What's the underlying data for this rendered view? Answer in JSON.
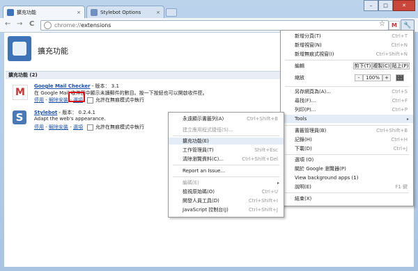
{
  "window": {
    "min_label": "–",
    "max_label": "□",
    "close_label": "✕",
    "tabs": [
      {
        "title": "擴充功能",
        "close": "×"
      },
      {
        "title": "Stylebot Options",
        "close": "×"
      }
    ]
  },
  "toolbar": {
    "back": "←",
    "forward": "→",
    "reload": "C",
    "url_prefix": "chrome://",
    "url_main": "extensions",
    "star": "☆",
    "gmail": "M",
    "wrench": "🔧"
  },
  "page": {
    "title": "擴充功能",
    "section": "擴充功能 (2)",
    "extensions": [
      {
        "icon": "gmail-icon",
        "icon_glyph": "M",
        "name": "Google Mail Checker",
        "version": " - 版本： 3.1",
        "description": "在 Google Mail 收件匣中顯示未讀郵件的數目。按一下按鈕也可以開啟收件匣。",
        "links": [
          "停用",
          "解除安裝",
          "選項"
        ],
        "incognito": "允許在無痕模式中執行"
      },
      {
        "icon": "stylebot-icon",
        "icon_glyph": "S",
        "name": "Stylebot",
        "version": " - 版本： 0.2.4.1",
        "description": "Adapt the web's appearance.",
        "links": [
          "停用",
          "解除安裝",
          "選項"
        ],
        "incognito": "允許在無痕模式中執行"
      }
    ]
  },
  "main_menu": {
    "items": [
      {
        "label": "新增分頁(T)",
        "shortcut": "Ctrl+T"
      },
      {
        "label": "新增視窗(N)",
        "shortcut": "Ctrl+N"
      },
      {
        "label": "新增無痕式視窗(I)",
        "shortcut": "Ctrl+Shift+N"
      },
      {
        "label": "編輯",
        "buttons": [
          "剪下(T)",
          "複製(C)",
          "貼上(P)"
        ]
      },
      {
        "label": "縮放",
        "zoom_minus": "-",
        "zoom_value": "100%",
        "zoom_plus": "+"
      },
      {
        "label": "另存網頁為(A)...",
        "shortcut": "Ctrl+S"
      },
      {
        "label": "尋找(F)...",
        "shortcut": "Ctrl+F"
      },
      {
        "label": "列印(P)...",
        "shortcut": "Ctrl+P"
      },
      {
        "label": "Tools",
        "submenu": "▸"
      },
      {
        "label": "書籤管理員(B)",
        "shortcut": "Ctrl+Shift+B"
      },
      {
        "label": "記錄(H)",
        "shortcut": "Ctrl+H"
      },
      {
        "label": "下載(D)",
        "shortcut": "Ctrl+J"
      },
      {
        "label": "選項 (O)",
        "shortcut": ""
      },
      {
        "label": "關於 Google 瀏覽器(P)",
        "shortcut": ""
      },
      {
        "label": "View background apps (1)",
        "shortcut": ""
      },
      {
        "label": "說明(E)",
        "shortcut": "F1 鍵"
      },
      {
        "label": "結束(X)",
        "shortcut": ""
      }
    ]
  },
  "tools_menu": {
    "items": [
      {
        "label": "永遠顯示書籤列(A)",
        "shortcut": "Ctrl+Shift+B"
      },
      {
        "label": "建立應用程式捷徑(S)...",
        "shortcut": "",
        "disabled": true
      },
      {
        "label": "擴充功能(E)",
        "shortcut": ""
      },
      {
        "label": "工作管理員(T)",
        "shortcut": "Shift+Esc"
      },
      {
        "label": "清除瀏覽資料(C)...",
        "shortcut": "Ctrl+Shift+Del"
      },
      {
        "label": "Report an Issue...",
        "shortcut": ""
      },
      {
        "label": "編碼(E)",
        "shortcut": "",
        "disabled": true,
        "submenu": "▸"
      },
      {
        "label": "檢視原始碼(O)",
        "shortcut": "Ctrl+U"
      },
      {
        "label": "開發人員工具(D)",
        "shortcut": "Ctrl+Shift+I"
      },
      {
        "label": "JavaScript 控制台(J)",
        "shortcut": "Ctrl+Shift+J"
      }
    ]
  },
  "colors": {
    "highlight": "#dd1111",
    "link": "#1a4fb0"
  }
}
